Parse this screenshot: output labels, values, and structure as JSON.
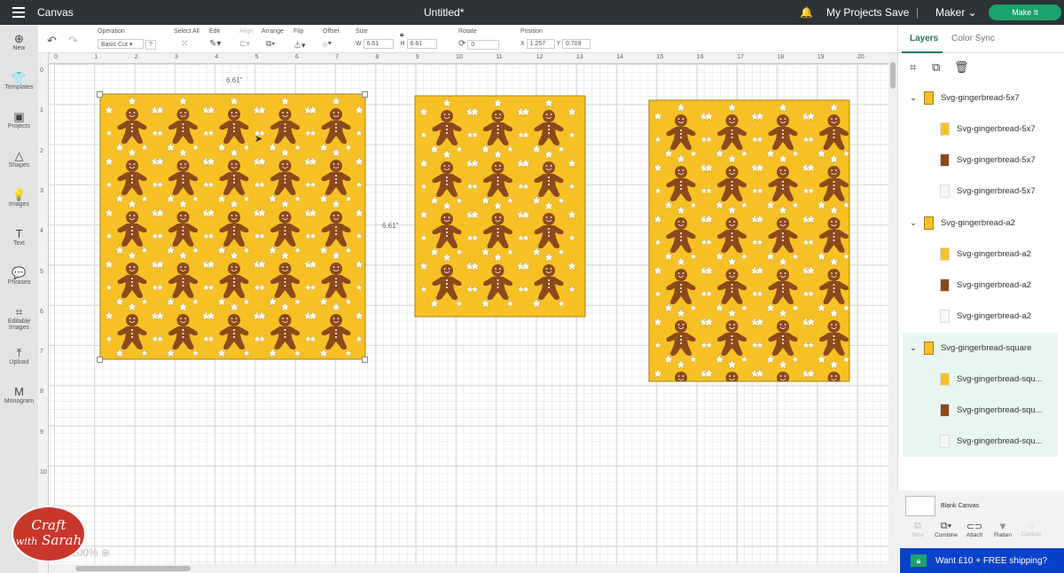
{
  "topbar": {
    "title": "Canvas",
    "document": "Untitled*",
    "my_projects": "My Projects",
    "save": "Save",
    "machine": "Maker",
    "make_it": "Make It"
  },
  "toolbar": {
    "operation_label": "Operation",
    "operation_value": "Basic Cut",
    "help": "?",
    "select_all": "Select All",
    "edit": "Edit",
    "align": "Align",
    "arrange": "Arrange",
    "flip": "Flip",
    "offset": "Offset",
    "size": "Size",
    "w_label": "W",
    "w": "6.61",
    "h_label": "H",
    "h": "6.61",
    "rotate": "Rotate",
    "rotate_value": "0",
    "position": "Position",
    "x_label": "X",
    "x": "1.257",
    "y_label": "Y",
    "y": "0.709"
  },
  "sidebar": {
    "items": [
      {
        "label": "New",
        "icon": "⊕"
      },
      {
        "label": "Templates",
        "icon": "👕"
      },
      {
        "label": "Projects",
        "icon": "▣"
      },
      {
        "label": "Shapes",
        "icon": "△"
      },
      {
        "label": "Images",
        "icon": "💡"
      },
      {
        "label": "Text",
        "icon": "T"
      },
      {
        "label": "Phrases",
        "icon": "💬"
      },
      {
        "label": "Editable Images",
        "icon": "⌗"
      },
      {
        "label": "Upload",
        "icon": "⤒"
      },
      {
        "label": "Monogram",
        "icon": "M"
      }
    ]
  },
  "ruler": {
    "top": [
      "0",
      "1",
      "2",
      "3",
      "4",
      "5",
      "6",
      "7",
      "8",
      "9",
      "10",
      "11",
      "12",
      "13",
      "14",
      "15",
      "16",
      "17",
      "18",
      "19",
      "20"
    ],
    "left": [
      "0",
      "1",
      "2",
      "3",
      "4",
      "5",
      "6",
      "7",
      "8",
      "9",
      "10"
    ]
  },
  "canvas": {
    "width_dim": "6.61\"",
    "height_dim": "6.61\"",
    "zoom": "100%",
    "bg_color": "#f7c125",
    "gingerbread_color": "#8a4a1c",
    "star_color": "#fffbe9"
  },
  "panel": {
    "tabs": [
      "Layers",
      "Color Sync"
    ],
    "groups": [
      {
        "name": "Svg-gingerbread-5x7",
        "children": [
          "Svg-gingerbread-5x7",
          "Svg-gingerbread-5x7",
          "Svg-gingerbread-5x7"
        ]
      },
      {
        "name": "Svg-gingerbread-a2",
        "children": [
          "Svg-gingerbread-a2",
          "Svg-gingerbread-a2",
          "Svg-gingerbread-a2"
        ]
      },
      {
        "name": "Svg-gingerbread-square",
        "children": [
          "Svg-gingerbread-squ...",
          "Svg-gingerbread-squ...",
          "Svg-gingerbread-squ..."
        ]
      }
    ],
    "blank_canvas": "Blank Canvas",
    "actions": [
      "Slice",
      "Combine",
      "Attach",
      "Flatten",
      "Contour"
    ],
    "promo": "Want £10 + FREE shipping?"
  },
  "logo": {
    "text": "Craft with Sarah"
  }
}
